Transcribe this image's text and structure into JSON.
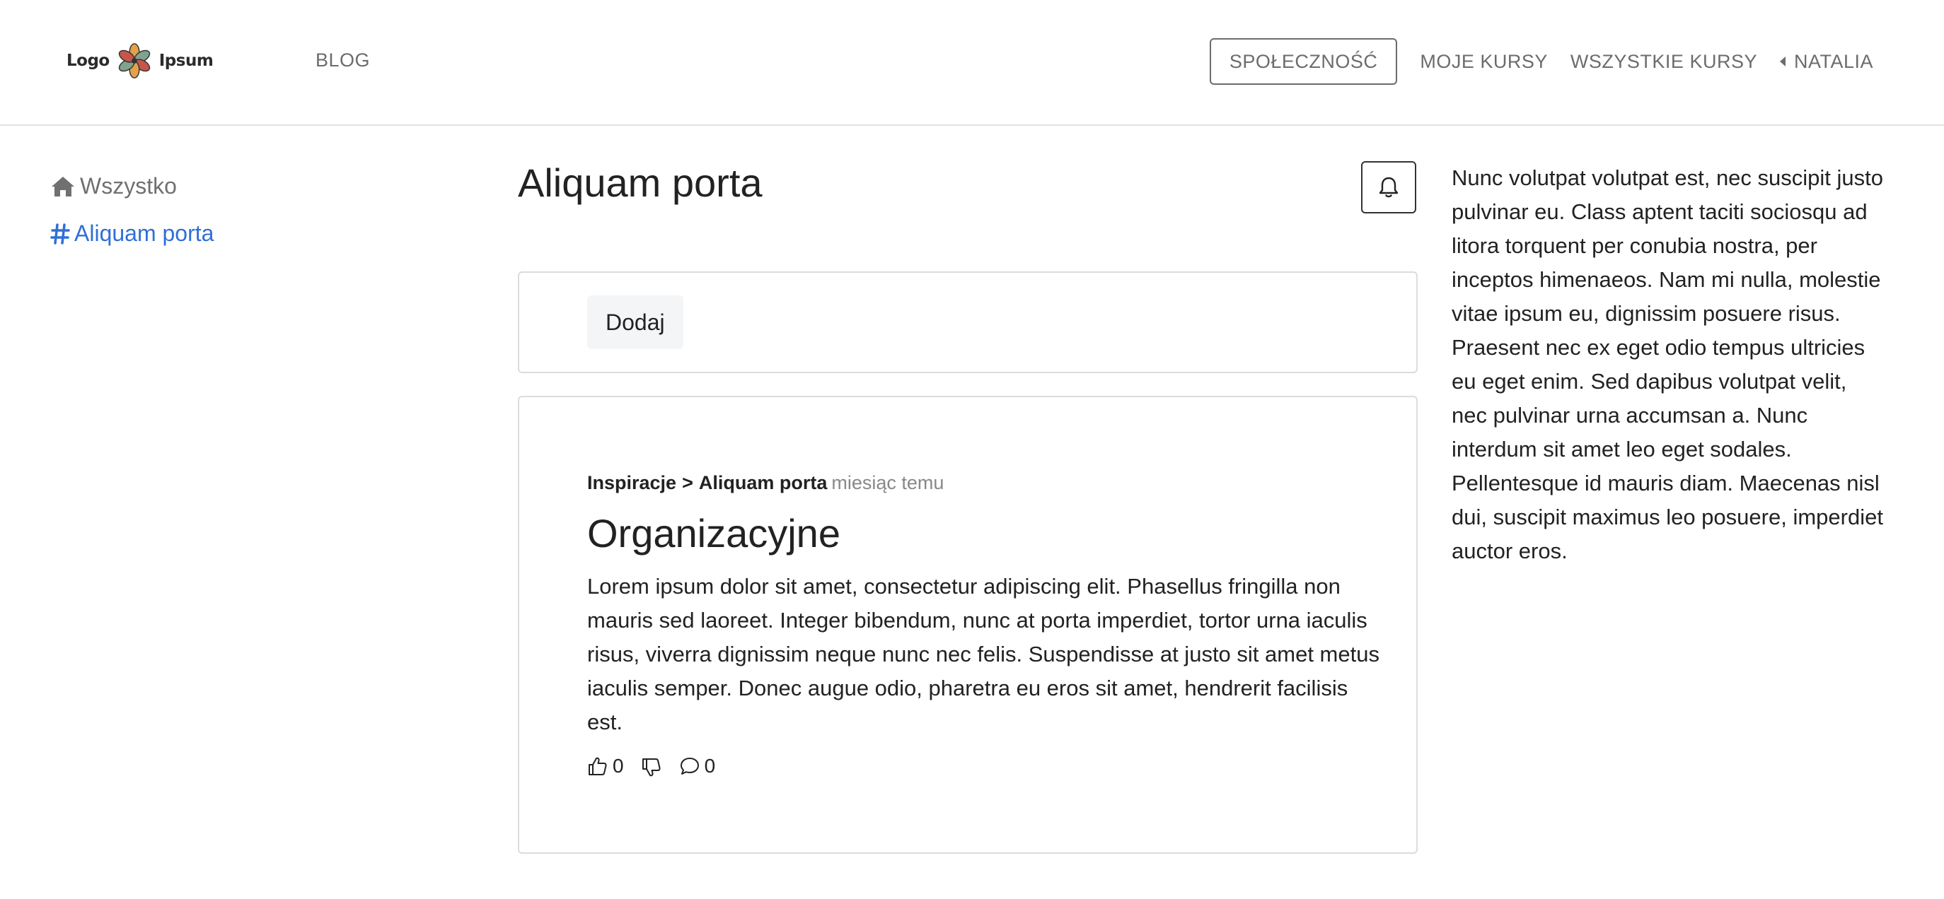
{
  "header": {
    "logo_left": "Logo",
    "logo_right": "Ipsum",
    "nav_blog": "BLOG",
    "nav_community": "SPOŁECZNOŚĆ",
    "nav_my_courses": "MOJE KURSY",
    "nav_all_courses": "WSZYSTKIE KURSY",
    "nav_user": "NATALIA"
  },
  "sidebar": {
    "items": [
      {
        "label": "Wszystko",
        "icon": "home-icon"
      },
      {
        "label": "Aliquam porta",
        "icon": "hash-icon",
        "color": "#2f6fd8"
      }
    ]
  },
  "main": {
    "title": "Aliquam porta",
    "add_label": "Dodaj",
    "post": {
      "category": "Inspiracje",
      "separator": ">",
      "channel": "Aliquam porta",
      "time": "miesiąc temu",
      "title": "Organizacyjne",
      "body": "Lorem ipsum dolor sit amet, consectetur adipiscing elit. Phasellus fringilla non mauris sed laoreet. Integer bibendum, nunc at porta imperdiet, tortor urna iaculis risus, viverra dignissim neque nunc nec felis. Suspendisse at justo sit amet metus iaculis semper. Donec augue odio, pharetra eu eros sit amet, hendrerit facilisis est.",
      "likes": "0",
      "comments": "0"
    }
  },
  "aside": {
    "text": "Nunc volutpat volutpat est, nec suscipit justo pulvinar eu. Class aptent taciti sociosqu ad litora torquent per conubia nostra, per inceptos himenaeos. Nam mi nulla, molestie vitae ipsum eu, dignissim posuere risus. Praesent nec ex eget odio tempus ultricies eu eget enim. Sed dapibus volutpat velit, nec pulvinar urna accumsan a. Nunc interdum sit amet leo eget sodales. Pellentesque id mauris diam. Maecenas nisl dui, suscipit maximus leo posuere, imperdiet auctor eros."
  }
}
